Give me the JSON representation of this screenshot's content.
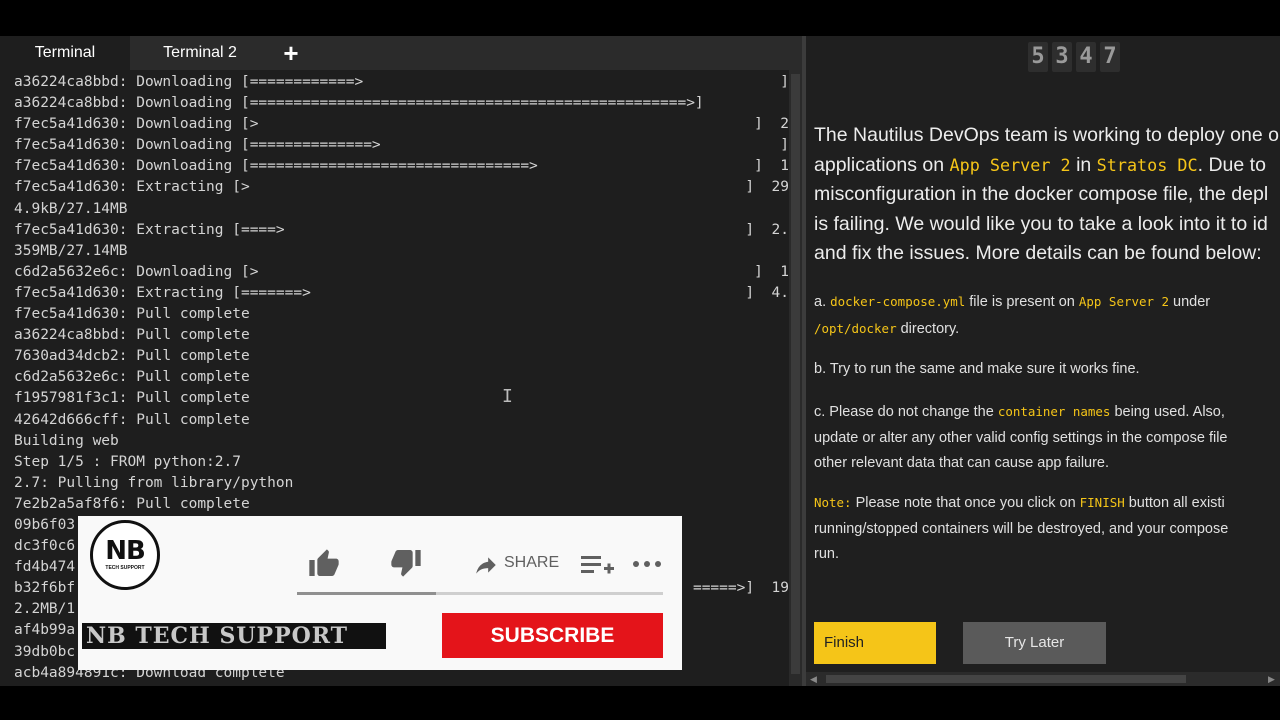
{
  "terminal": {
    "tabs": [
      {
        "label": "Terminal"
      },
      {
        "label": "Terminal 2"
      }
    ],
    "add_tab_label": "+",
    "lines": [
      {
        "text": "a36224ca8bbd: Downloading [============>",
        "right": "]"
      },
      {
        "text": "a36224ca8bbd: Downloading [==================================================>]",
        "right": ""
      },
      {
        "text": "f7ec5a41d630: Downloading [>",
        "right": "]  2"
      },
      {
        "text": "f7ec5a41d630: Downloading [==============>",
        "right": "]"
      },
      {
        "text": "f7ec5a41d630: Downloading [================================>",
        "right": "]  1"
      },
      {
        "text": "f7ec5a41d630: Extracting [>",
        "right": "]  29"
      },
      {
        "text": "4.9kB/27.14MB",
        "right": ""
      },
      {
        "text": "f7ec5a41d630: Extracting [====>",
        "right": "]  2."
      },
      {
        "text": "359MB/27.14MB",
        "right": ""
      },
      {
        "text": "c6d2a5632e6c: Downloading [>",
        "right": "]  1"
      },
      {
        "text": "f7ec5a41d630: Extracting [=======>",
        "right": "]  4."
      },
      {
        "text": "f7ec5a41d630: Pull complete",
        "right": ""
      },
      {
        "text": "a36224ca8bbd: Pull complete",
        "right": ""
      },
      {
        "text": "7630ad34dcb2: Pull complete",
        "right": ""
      },
      {
        "text": "c6d2a5632e6c: Pull complete",
        "right": ""
      },
      {
        "text": "f1957981f3c1: Pull complete",
        "right": ""
      },
      {
        "text": "42642d666cff: Pull complete",
        "right": ""
      },
      {
        "text": "Building web",
        "right": ""
      },
      {
        "text": "Step 1/5 : FROM python:2.7",
        "right": ""
      },
      {
        "text": "2.7: Pulling from library/python",
        "right": ""
      },
      {
        "text": "7e2b2a5af8f6: Pull complete",
        "right": ""
      },
      {
        "text": "09b6f03",
        "right": ""
      },
      {
        "text": "dc3f0c6",
        "right": ""
      },
      {
        "text": "fd4b474",
        "right": ""
      },
      {
        "text": "b32f6bf",
        "right": "=====>]  19"
      },
      {
        "text": "2.2MB/1",
        "right": ""
      },
      {
        "text": "af4b99a",
        "right": ""
      },
      {
        "text": "39db0bc",
        "right": ""
      },
      {
        "text": "acb4a894891c: Download complete",
        "right": ""
      }
    ]
  },
  "timer": {
    "digits": [
      "5",
      "3",
      "4",
      "7"
    ]
  },
  "task": {
    "intro_1": "The Nautilus DevOps team is working to deploy one o",
    "intro_2_pre": "applications on ",
    "intro_2_server": "App Server 2",
    "intro_2_mid": " in ",
    "intro_2_dc": "Stratos DC",
    "intro_2_post": ". Due to",
    "intro_3": "misconfiguration in the docker compose file, the depl",
    "intro_4": "is failing. We would like you to take a look into it to id",
    "intro_5": "and fix the issues. More details can be found below:",
    "a_pre": "a. ",
    "a_file": "docker-compose.yml",
    "a_mid": " file is present on ",
    "a_server": "App Server 2",
    "a_post": " under",
    "a_dir": "/opt/docker",
    "a_dir_post": " directory.",
    "b": "b. Try to run the same and make sure it works fine.",
    "c_pre": "c. Please do not change the ",
    "c_hl": "container names",
    "c_post": " being used. Also,",
    "c_2": "update or alter any other valid config settings in the compose file",
    "c_3": "other relevant data that can cause app failure.",
    "note_label": "Note:",
    "note_pre": " Please note that once you click on ",
    "note_finish": "FINISH",
    "note_post": " button all existi",
    "note_2": "running/stopped containers will be destroyed, and your compose",
    "note_3": "run.",
    "finish_label": "Finish",
    "later_label": "Try Later"
  },
  "overlay": {
    "logo_text": "NB",
    "logo_subtext": "TECH SUPPORT",
    "share_label": "SHARE",
    "channel_name": "NB TECH SUPPORT",
    "subscribe_label": "SUBSCRIBE",
    "progress_fraction": 0.38
  },
  "colors": {
    "accent": "#f5c518",
    "subscribe": "#e4141a",
    "terminal_bg": "#1e1e1e"
  }
}
